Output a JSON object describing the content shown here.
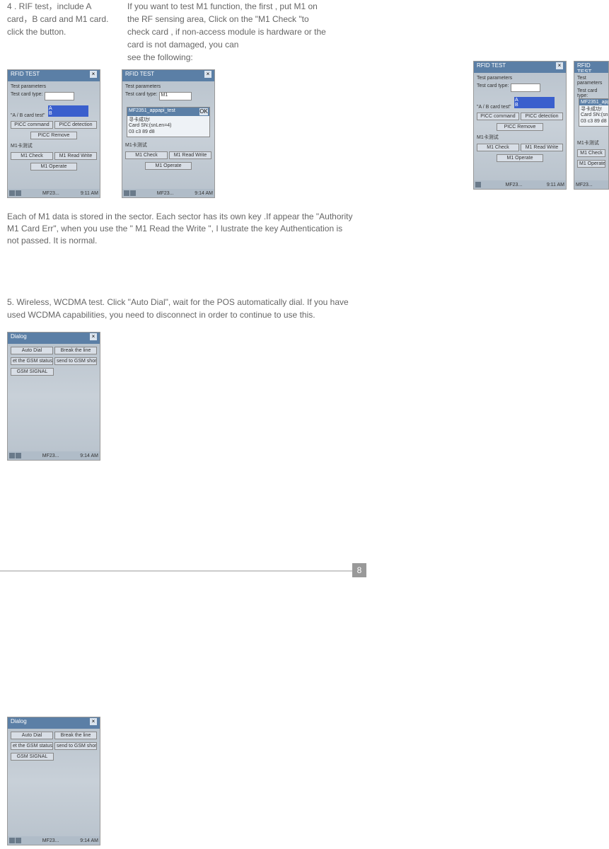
{
  "section4": {
    "left": "4 . RIF test，include A card，B card and M1 card. click the button.",
    "right_l1": "If you want to test M1 function, the first , put M1 on",
    "right_l2": "the RF sensing area, Click on the \"M1 Check \"to",
    "right_l3": "check card , if non-access module is hardware or the",
    "right_l4": "card is not damaged, you can",
    "right_l5": "see the following:"
  },
  "rfid": {
    "title": "RFID TEST",
    "params": "Test parameters",
    "card_type": "Test card type:",
    "ab_test": "\"A / B card test\"",
    "picc_cmd": "PICC command",
    "picc_det": "PICC detection",
    "picc_rem": "PICC Remove",
    "m1_group": "M1卡测试",
    "m1_check": "M1 Check",
    "m1_rw": "M1 Read Write",
    "m1_op": "M1 Operate",
    "sel_m1": "M1",
    "popup_title": "MF2351_appapi_test",
    "popup_ok": "OK",
    "popup_l1": "寻卡成功!",
    "popup_l2": "Card SN:(snLen=4)",
    "popup_l3": "03 c3 89 d8",
    "task": "MF23...",
    "time1": "9:11 AM",
    "time2": "9:14 AM"
  },
  "mid_para": "Each of M1 data is stored in the sector. Each sector has its own key .If appear the \"Authority M1 Card Err\", when you use the \" M1 Read the Write \", I lustrate the key Authentication is not passed. It is normal.",
  "section5_text": "5. Wireless, WCDMA test. Click \"Auto Dial\", wait for the POS automatically dial. If you have used WCDMA capabilities,  you need to disconnect in order to continue to use this.",
  "dialog": {
    "title": "Dialog",
    "auto_dial": "Auto Dial",
    "break": "Break the line",
    "gsm_status": "et the GSM status",
    "send_gsm": "send to GSM short",
    "gsm_signal": "GSM SIGNAL",
    "time": "9:14 AM",
    "task": "MF23..."
  },
  "page_number": "8"
}
